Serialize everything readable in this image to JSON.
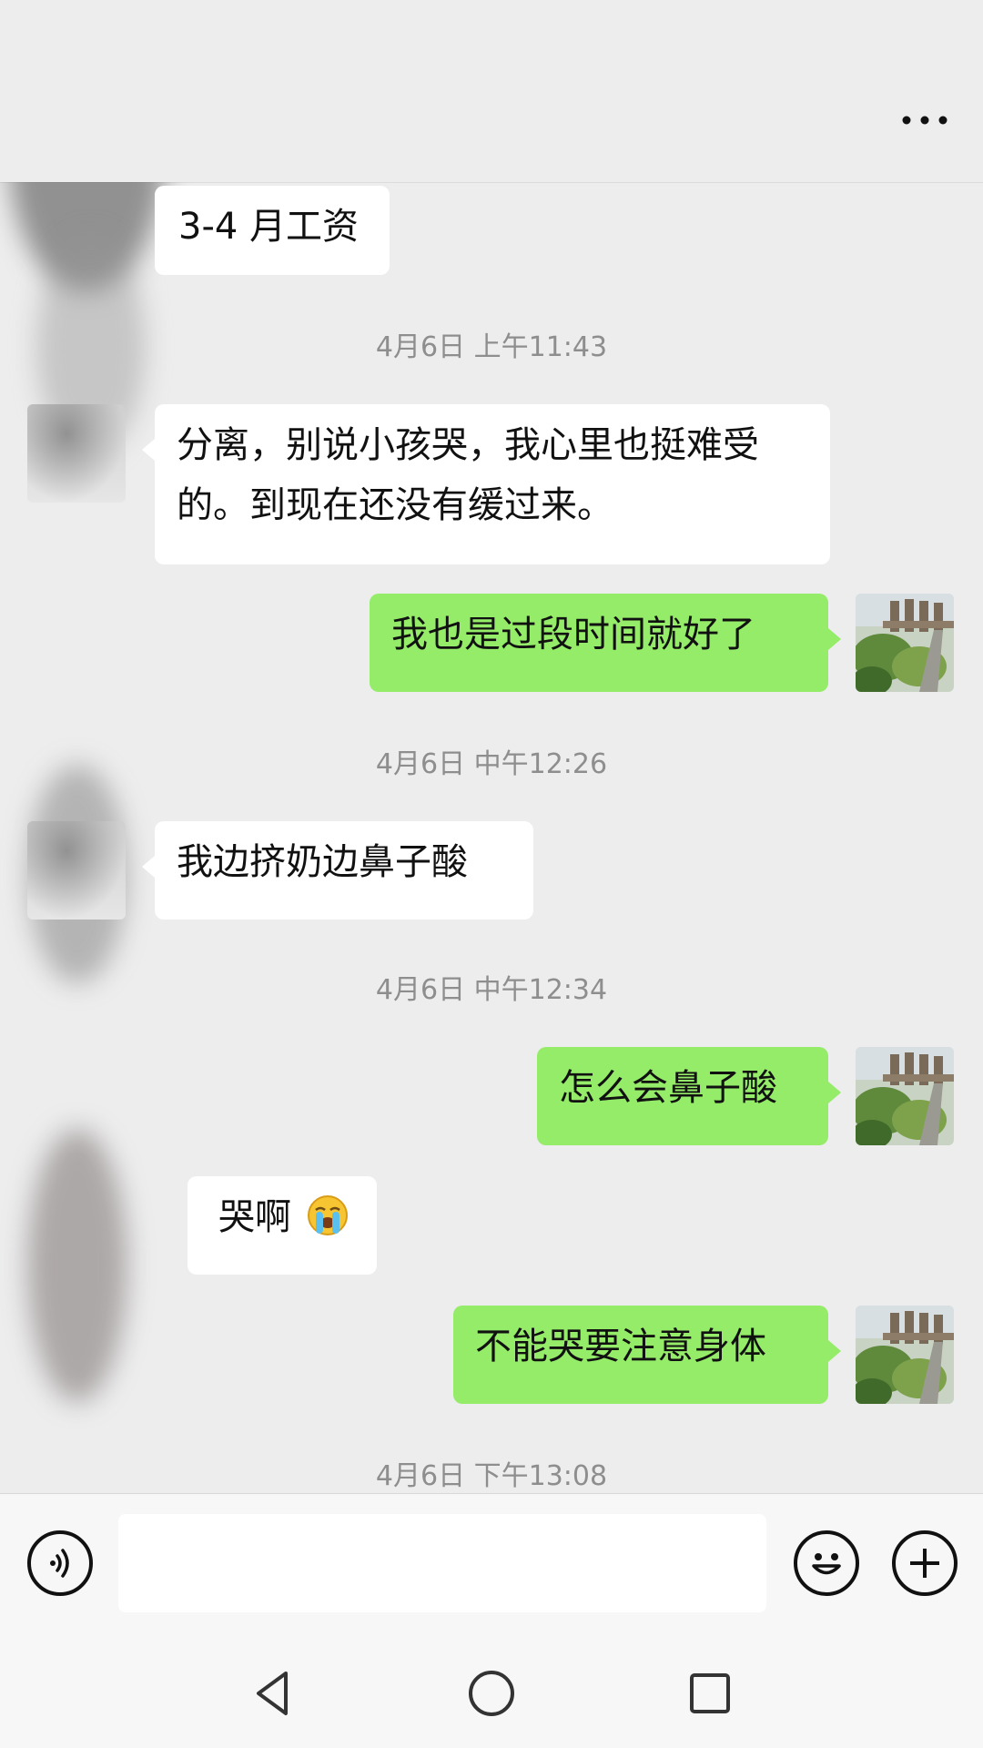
{
  "header": {
    "more_icon": "ellipsis-icon"
  },
  "messages": [
    {
      "id": "m1",
      "side": "in",
      "text": "3-4 月工资"
    },
    {
      "id": "t1",
      "type": "timestamp",
      "text": "4月6日 上午11:43"
    },
    {
      "id": "m2",
      "side": "in",
      "text": "分离，别说小孩哭，我心里也挺难受的。到现在还没有缓过来。"
    },
    {
      "id": "m3",
      "side": "out",
      "text": "我也是过段时间就好了"
    },
    {
      "id": "t2",
      "type": "timestamp",
      "text": "4月6日 中午12:26"
    },
    {
      "id": "m4",
      "side": "in",
      "text": "我边挤奶边鼻子酸"
    },
    {
      "id": "t3",
      "type": "timestamp",
      "text": "4月6日 中午12:34"
    },
    {
      "id": "m5",
      "side": "out",
      "text": "怎么会鼻子酸"
    },
    {
      "id": "m6",
      "side": "in",
      "text": "哭啊",
      "emoji": "loudly-crying-face-icon"
    },
    {
      "id": "m7",
      "side": "out",
      "text": "不能哭要注意身体"
    },
    {
      "id": "t4",
      "type": "timestamp",
      "text": "4月6日 下午13:08"
    }
  ],
  "input_bar": {
    "voice_icon": "voice-icon",
    "message_value": "",
    "emoji_icon": "emoji-icon",
    "plus_icon": "plus-icon"
  },
  "nav": {
    "back_icon": "back-triangle-icon",
    "home_icon": "home-circle-icon",
    "recents_icon": "recents-square-icon"
  },
  "colors": {
    "background": "#ededed",
    "incoming_bubble": "#ffffff",
    "outgoing_bubble": "#95ec69",
    "timestamp_text": "#8e8e8e"
  }
}
